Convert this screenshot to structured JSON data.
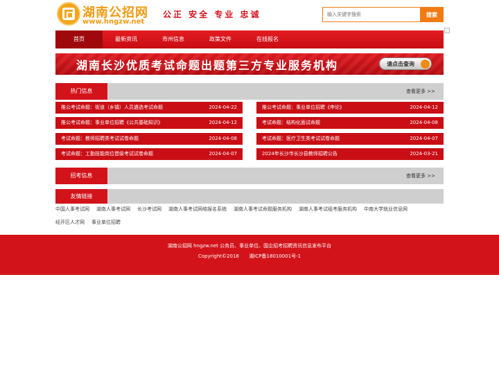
{
  "header": {
    "logo_title": "湖南公招网",
    "logo_url": "www.hngzw.net",
    "slogan": "公正 安全 专业 忠诚",
    "search_placeholder": "输入关键字搜索",
    "search_button": "搜索"
  },
  "nav": {
    "items": [
      "首页",
      "最新资讯",
      "市州信息",
      "政策文件",
      "在线报名"
    ],
    "active_index": 0
  },
  "banner": {
    "text": "湖南长沙优质考试命题出题第三方专业服务机构",
    "button": "请点击查询"
  },
  "hot": {
    "title": "热门信息",
    "more": "查看更多 >>",
    "items": [
      {
        "title": "推公考试命题：街道（乡镇）人员遴选考试命题",
        "date": "2024-04-22"
      },
      {
        "title": "推公考试命题：事业单位招聘《申论》",
        "date": "2024-04-12"
      },
      {
        "title": "推公考试命题：事业单位招聘《公共基础知识》",
        "date": "2024-04-12"
      },
      {
        "title": "考试命题：结构化面试命题",
        "date": "2024-04-08"
      },
      {
        "title": "考试命题：教师招聘类考试试卷命题",
        "date": "2024-04-08"
      },
      {
        "title": "考试命题：医疗卫生类考试试卷命题",
        "date": "2024-04-07"
      },
      {
        "title": "考试命题：工勤技能岗位晋级考试试卷命题",
        "date": "2024-04-07"
      },
      {
        "title": "2024年长沙市长沙县教师招聘公告",
        "date": "2024-03-21"
      }
    ]
  },
  "recruit": {
    "title": "招考信息",
    "more": "查看更多 >>"
  },
  "friends": {
    "title": "友情链接",
    "links": [
      "中国人事考试网",
      "湖南人事考试网",
      "长沙考试网",
      "湖南人事考试网络报名系统",
      "湖南人事考试命题服务机构",
      "湖南人事考试组考服务机构",
      "中南大学就业信息网",
      "经开区人才网",
      "事业单位招聘"
    ]
  },
  "footer": {
    "line1": "湖南公招网 hngzw.net 公务员、事业单位、国企招考招聘资讯信息发布平台",
    "copyright": "Copyright©2018",
    "icp": "湘ICP备18010001号-1"
  },
  "colors": {
    "brand_red": "#d3131a",
    "accent_orange": "#f07b13",
    "logo_gold": "#f09b12"
  }
}
